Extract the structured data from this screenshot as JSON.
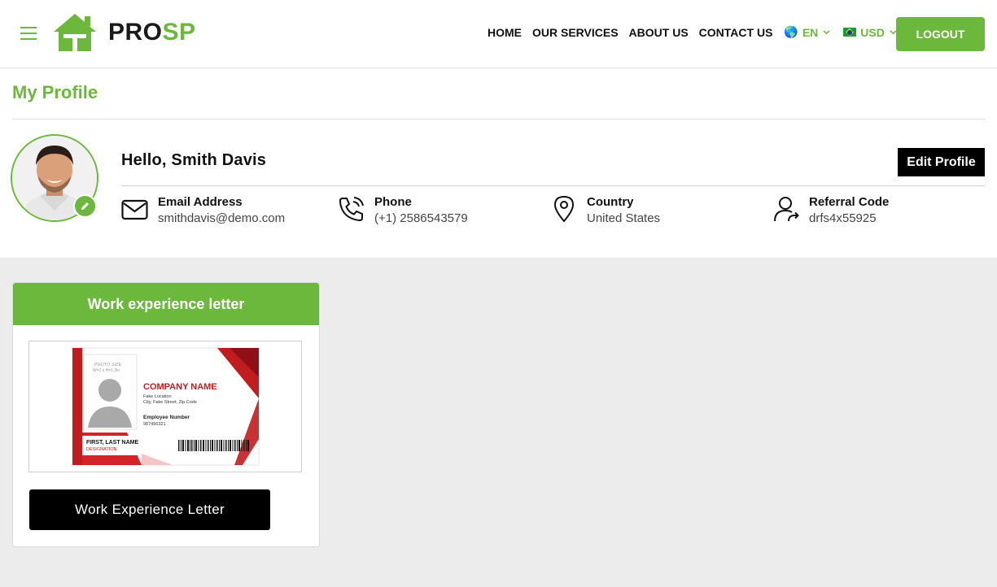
{
  "brand": {
    "name_part1": "PRO",
    "name_part2": "SP",
    "accent": "#6bb83c"
  },
  "nav": {
    "links": [
      "HOME",
      "OUR SERVICES",
      "ABOUT US",
      "CONTACT US"
    ],
    "language": {
      "selected": "EN",
      "icon": "globe-icon"
    },
    "currency": {
      "selected": "USD",
      "icon": "brazil-flag-icon"
    },
    "logout_label": "LOGOUT"
  },
  "profile": {
    "page_title": "My Profile",
    "greeting": "Hello, Smith Davis",
    "edit_label": "Edit Profile",
    "fields": [
      {
        "label": "Email Address",
        "value": "smithdavis@demo.com",
        "icon": "envelope-icon"
      },
      {
        "label": "Phone",
        "value": "(+1) 2586543579",
        "icon": "phone-icon"
      },
      {
        "label": "Country",
        "value": "United States",
        "icon": "location-pin-icon"
      },
      {
        "label": "Referral Code",
        "value": "drfs4x55925",
        "icon": "user-share-icon"
      }
    ]
  },
  "card": {
    "title": "Work experience letter",
    "button_label": "Work Experience Letter",
    "preview": {
      "company": "COMPANY NAME",
      "photo_caption": "PHOTO SIZE",
      "photo_size": "W=1 x H=1.2in",
      "address1": "Fake Location",
      "address2": "City, Fake Street, Zip Code",
      "employee_label": "Employee Number",
      "employee_number": "987456321",
      "name": "FIRST, LAST NAME",
      "designation": "DESIGNATION"
    }
  }
}
